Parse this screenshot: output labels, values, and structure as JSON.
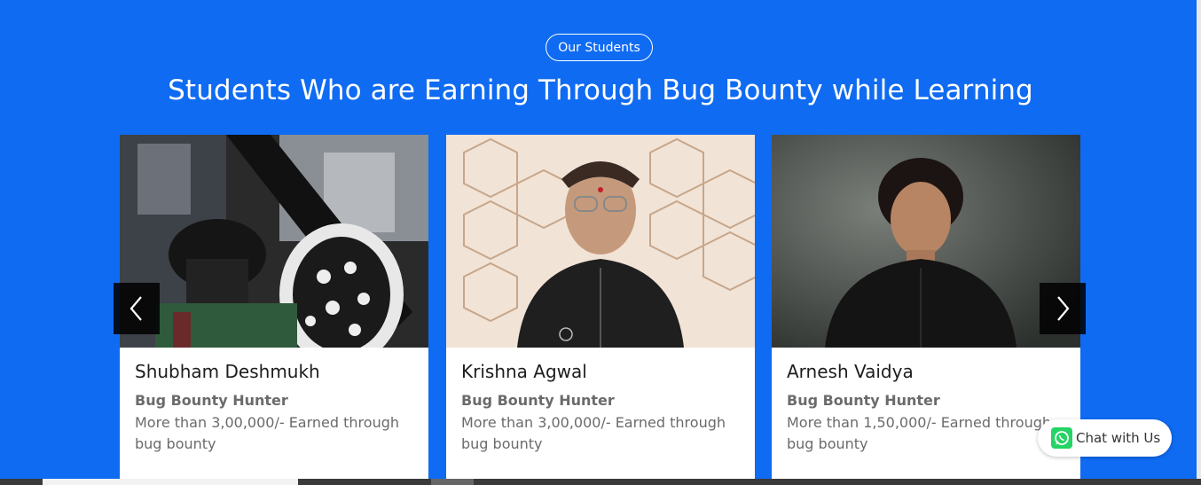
{
  "section": {
    "pill_label": "Our Students",
    "heading": "Students Who are Earning Through Bug Bounty while Learning"
  },
  "students": [
    {
      "name": "Shubham Deshmukh",
      "role": "Bug Bounty Hunter",
      "description": "More than 3,00,000/- Earned through bug bounty"
    },
    {
      "name": "Krishna Agwal",
      "role": "Bug Bounty Hunter",
      "description": "More than 3,00,000/- Earned through bug bounty"
    },
    {
      "name": "Arnesh Vaidya",
      "role": "Bug Bounty Hunter",
      "description": "More than 1,50,000/- Earned through bug bounty"
    }
  ],
  "carousel": {
    "prev_icon": "chevron-left-icon",
    "next_icon": "chevron-right-icon"
  },
  "chat": {
    "label": "Chat with Us",
    "icon": "whatsapp-icon"
  },
  "colors": {
    "background": "#0f6bf2",
    "card": "#ffffff",
    "role_text": "#6b6b6b",
    "whatsapp": "#25d366"
  }
}
